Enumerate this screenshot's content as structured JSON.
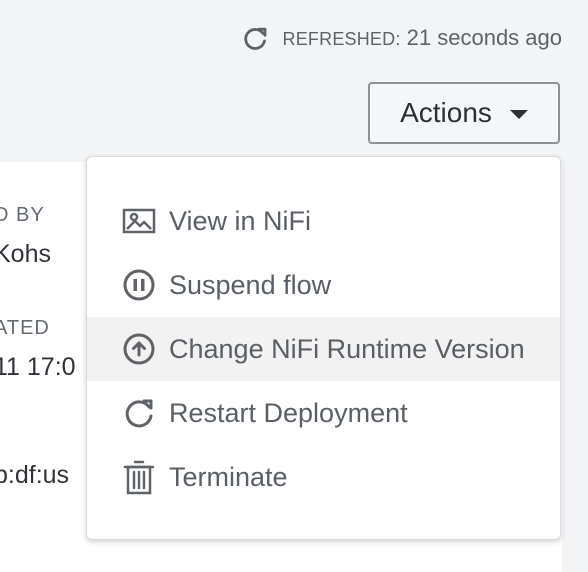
{
  "refresh": {
    "label": "REFRESHED:",
    "value": "21 seconds ago",
    "icon": "refresh-icon"
  },
  "actions": {
    "label": "Actions",
    "icon": "chevron-down-icon"
  },
  "background_content": {
    "deployed_by_label": "D BY",
    "deployed_by_value": "Kohs",
    "updated_label": "ATED",
    "updated_value": "11 17:0",
    "crn_value": "p:df:us"
  },
  "menu": {
    "items": [
      {
        "label": "View in NiFi",
        "icon": "image-icon"
      },
      {
        "label": "Suspend flow",
        "icon": "pause-icon"
      },
      {
        "label": "Change NiFi Runtime Version",
        "icon": "upload-circle-icon"
      },
      {
        "label": "Restart Deployment",
        "icon": "restart-icon"
      },
      {
        "label": "Terminate",
        "icon": "trash-icon"
      }
    ]
  },
  "colors": {
    "page_background": "#f3f4f6",
    "panel_background": "#ffffff",
    "button_border": "#8d9196",
    "menu_text": "#5a5f66",
    "highlight_background": "#f2f2f2"
  }
}
